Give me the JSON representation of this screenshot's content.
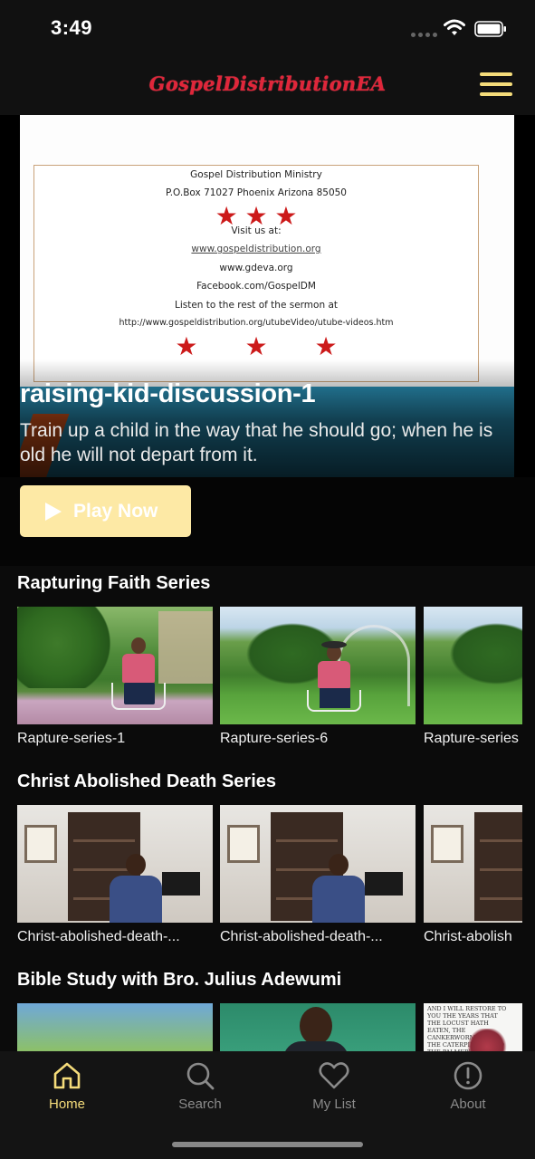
{
  "status_bar": {
    "time": "3:49"
  },
  "header": {
    "title": "GospelDistributionEA",
    "title_color": "#e0263a",
    "menu_icon": "hamburger-menu-icon",
    "accent_color": "#f5dc7a"
  },
  "hero": {
    "card_lines": [
      "Gospel Distribution Ministry",
      "P.O.Box 71027 Phoenix Arizona 85050",
      "Visit us at:",
      "www.gospeldistribution.org",
      "www.gdeva.org",
      "Facebook.com/GospelDM",
      "Listen to the rest of the sermon at",
      "http://www.gospeldistribution.org/utubeVideo/utube-videos.htm"
    ],
    "title": "raising-kid-discussion-1",
    "description": "Train up a child in the way that he should go; when he is old he will not depart from it.",
    "play_label": "Play Now",
    "play_button_color": "#fde9a5"
  },
  "sections": [
    {
      "title": "Rapturing Faith Series",
      "items": [
        "Rapture-series-1",
        "Rapture-series-6",
        "Rapture-series"
      ]
    },
    {
      "title": "Christ Abolished Death Series",
      "items": [
        "Christ-abolished-death-...",
        "Christ-abolished-death-...",
        "Christ-abolish"
      ]
    },
    {
      "title": "Bible Study with Bro. Julius Adewumi",
      "scripture_text": "AND I WILL RESTORE TO YOU THE YEARS THAT THE LOCUST HATH EATEN, THE CANKERWORM, AND THE CATERPILLER, AND THE PALMERWORM, MY GREAT ARMY WHICH I SENT AMONG YOU."
    }
  ],
  "tabs": [
    {
      "label": "Home",
      "icon": "home-icon",
      "active": true
    },
    {
      "label": "Search",
      "icon": "search-icon",
      "active": false
    },
    {
      "label": "My List",
      "icon": "heart-icon",
      "active": false
    },
    {
      "label": "About",
      "icon": "info-icon",
      "active": false
    }
  ]
}
